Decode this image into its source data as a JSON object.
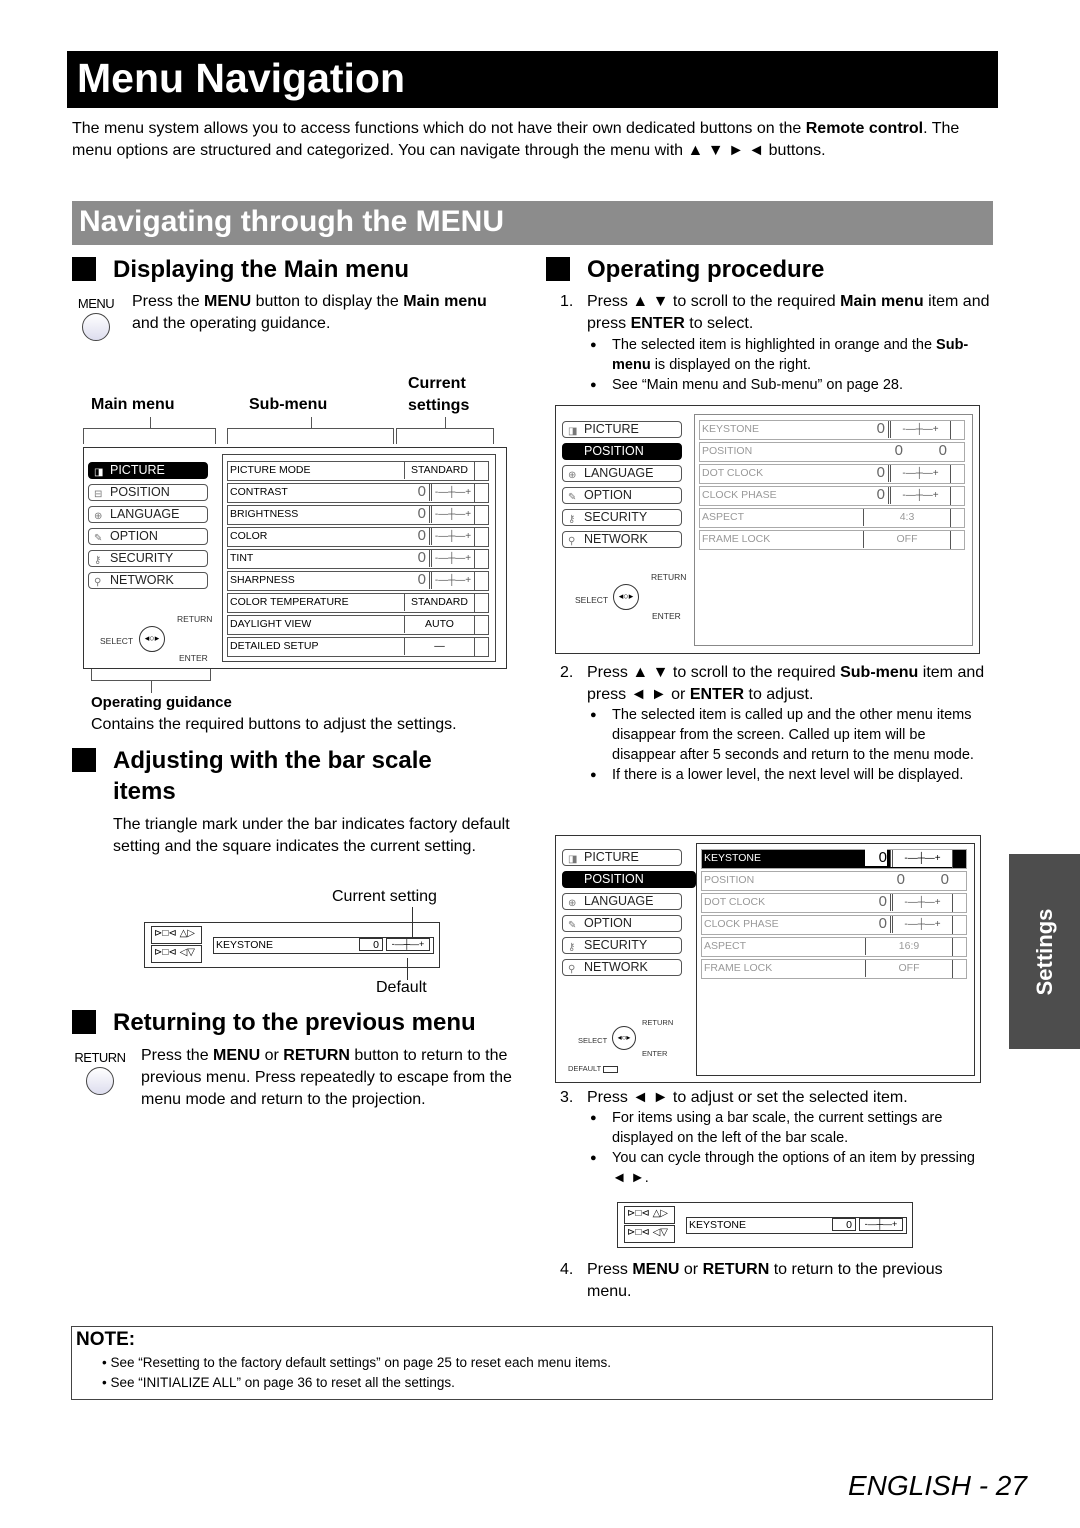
{
  "page_title": "Menu Navigation",
  "intro": {
    "part1": "The menu system allows you to access functions which do not have their own dedicated buttons on the ",
    "bold1": "Remote control",
    "part2": ". The menu options are structured and categorized. You can navigate through the menu with ▲ ▼ ► ◄ buttons."
  },
  "section_title": "Navigating through the MENU",
  "displaying": {
    "heading": "Displaying the Main menu",
    "button_label": "MENU",
    "text_a": "Press the ",
    "text_b": "MENU",
    "text_c": " button to display the ",
    "text_d": "Main menu",
    "text_e": " and the operating guidance.",
    "callouts": {
      "main_menu": "Main menu",
      "sub_menu": "Sub-menu",
      "current_1": "Current",
      "current_2": "settings"
    },
    "guidance_title": "Operating guidance",
    "guidance_text": "Contains the required buttons to adjust the settings."
  },
  "osd_main_menu": [
    {
      "label": "PICTURE",
      "icon": "picture-icon",
      "glyph": "◨"
    },
    {
      "label": "POSITION",
      "icon": "position-icon",
      "glyph": "⊟"
    },
    {
      "label": "LANGUAGE",
      "icon": "globe-icon",
      "glyph": "⊕"
    },
    {
      "label": "OPTION",
      "icon": "option-icon",
      "glyph": "✎"
    },
    {
      "label": "SECURITY",
      "icon": "key-icon",
      "glyph": "⚷"
    },
    {
      "label": "NETWORK",
      "icon": "network-icon",
      "glyph": "⚲"
    }
  ],
  "osd_guide": {
    "return": "RETURN",
    "select": "SELECT",
    "enter": "ENTER",
    "default": "DEFAULT"
  },
  "picture_submenu": [
    {
      "label": "PICTURE MODE",
      "value": "STANDARD"
    },
    {
      "label": "CONTRAST",
      "num": "0",
      "bar": "-—┼—+"
    },
    {
      "label": "BRIGHTNESS",
      "num": "0",
      "bar": "-—┼—+"
    },
    {
      "label": "COLOR",
      "num": "0",
      "bar": "-—┼—+"
    },
    {
      "label": "TINT",
      "num": "0",
      "bar": "-—┼—+"
    },
    {
      "label": "SHARPNESS",
      "num": "0",
      "bar": "-—┼—+"
    },
    {
      "label": "COLOR TEMPERATURE",
      "value": "STANDARD"
    },
    {
      "label": "DAYLIGHT VIEW",
      "value": "AUTO"
    },
    {
      "label": "DETAILED SETUP",
      "value": "—"
    }
  ],
  "position_submenu_1": [
    {
      "label": "KEYSTONE",
      "num": "0",
      "bar": "-—┼—+"
    },
    {
      "label": "POSITION",
      "h": "0",
      "v": "0"
    },
    {
      "label": "DOT CLOCK",
      "num": "0",
      "bar": "-—┼—+"
    },
    {
      "label": "CLOCK PHASE",
      "num": "0",
      "bar": "-—┼—+"
    },
    {
      "label": "ASPECT",
      "value": "4:3"
    },
    {
      "label": "FRAME LOCK",
      "value": "OFF"
    }
  ],
  "position_submenu_2": [
    {
      "label": "KEYSTONE",
      "num": "0",
      "bar": "-—┼—+"
    },
    {
      "label": "POSITION",
      "h": "0",
      "v": "0"
    },
    {
      "label": "DOT CLOCK",
      "num": "0",
      "bar": "-—┼—+"
    },
    {
      "label": "CLOCK PHASE",
      "num": "0",
      "bar": "-—┼—+"
    },
    {
      "label": "ASPECT",
      "value": "16:9"
    },
    {
      "label": "FRAME LOCK",
      "value": "OFF"
    }
  ],
  "adjusting": {
    "heading_1": "Adjusting with the bar scale",
    "heading_2": "items",
    "text": "The triangle mark under the bar indicates factory default setting and the square indicates the current setting.",
    "current_setting": "Current setting",
    "default": "Default",
    "keystone_label": "KEYSTONE",
    "keystone_value": "0"
  },
  "returning": {
    "heading": "Returning to the previous menu",
    "button_label": "RETURN",
    "text_a": "Press the ",
    "text_b": "MENU",
    "text_c": " or ",
    "text_d": "RETURN",
    "text_e": " button to return to the previous menu. Press repeatedly to escape from the menu mode and return to the projection."
  },
  "procedure": {
    "heading": "Operating procedure",
    "step1": {
      "n": "1.",
      "a": "Press ▲ ▼ to scroll to the required ",
      "b": "Main menu",
      "c": " item and press ",
      "d": "ENTER",
      "e": " to select."
    },
    "step1_bullets": [
      {
        "a": "The selected item is highlighted in orange and the ",
        "b": "Sub-menu",
        "c": " is displayed on the right."
      },
      {
        "a": "See “Main menu and Sub-menu” on page 28.",
        "b": "",
        "c": ""
      }
    ],
    "step2": {
      "n": "2.",
      "a": "Press ▲ ▼ to scroll to the required ",
      "b": "Sub-menu",
      "c": " item and press ◄ ► or ",
      "d": "ENTER",
      "e": " to adjust."
    },
    "step2_bullets": [
      "The selected item is called up and the other menu items disappear from the screen. Called up item will be disappear after 5 seconds and return to the menu mode.",
      "If there is a lower level, the next level will be displayed."
    ],
    "step3": {
      "n": "3.",
      "text": "Press ◄ ► to adjust or set the selected item."
    },
    "step3_bullets": [
      "For items using a bar scale, the current settings are displayed on the left of the bar scale.",
      "You can cycle through the options of an item by pressing ◄ ►."
    ],
    "step4": {
      "n": "4.",
      "a": "Press ",
      "b": "MENU",
      "c": " or ",
      "d": "RETURN",
      "e": " to return to the previous menu."
    }
  },
  "side_tab": "Settings",
  "note": {
    "title": "NOTE:",
    "items": [
      "•  See “Resetting to the factory default settings” on page 25 to reset each menu items.",
      "•  See “INITIALIZE ALL” on page 36 to reset all the settings."
    ]
  },
  "footer": "ENGLISH - 27"
}
